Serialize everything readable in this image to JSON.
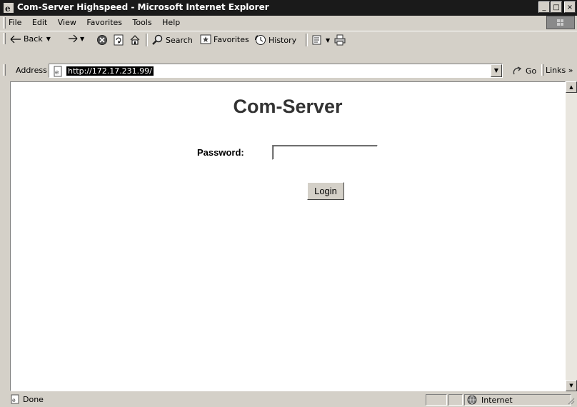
{
  "window": {
    "title": "Com-Server Highspeed - Microsoft Internet Explorer",
    "controls": {
      "minimize": "_",
      "maximize": "□",
      "close": "×"
    }
  },
  "menubar": {
    "items": [
      "File",
      "Edit",
      "View",
      "Favorites",
      "Tools",
      "Help"
    ]
  },
  "toolbar": {
    "back": "Back",
    "search": "Search",
    "favorites": "Favorites",
    "history": "History"
  },
  "address": {
    "label": "Address",
    "url": "http://172.17.231.99/",
    "go": "Go",
    "links": "Links »"
  },
  "page": {
    "heading": "Com-Server",
    "password_label": "Password:",
    "password_value": "",
    "login_label": "Login"
  },
  "statusbar": {
    "status": "Done",
    "zone": "Internet"
  }
}
